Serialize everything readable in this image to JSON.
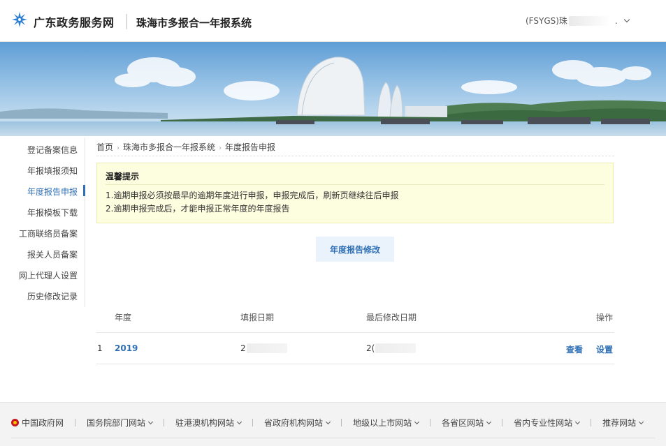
{
  "header": {
    "brand": "广东政务服务网",
    "system_title": "珠海市多报合一年报系统",
    "user_prefix": "(FSYGS)珠",
    "user_suffix": "."
  },
  "sidebar": {
    "items": [
      {
        "label": "登记备案信息",
        "active": false
      },
      {
        "label": "年报填报须知",
        "active": false
      },
      {
        "label": "年度报告申报",
        "active": true
      },
      {
        "label": "年报模板下载",
        "active": false
      },
      {
        "label": "工商联络员备案",
        "active": false
      },
      {
        "label": "报关人员备案",
        "active": false
      },
      {
        "label": "网上代理人设置",
        "active": false
      },
      {
        "label": "历史修改记录",
        "active": false
      }
    ]
  },
  "breadcrumb": {
    "items": [
      "首页",
      "珠海市多报合一年报系统",
      "年度报告申报"
    ],
    "separator": "›"
  },
  "notice": {
    "title": "温馨提示",
    "lines": [
      "1.逾期申报必须按最早的逾期年度进行申报，申报完成后，刷新页继续往后申报",
      "2.逾期申报完成后，才能申报正常年度的年度报告"
    ]
  },
  "actions": {
    "amend_label": "年度报告修改"
  },
  "table": {
    "headers": {
      "year": "年度",
      "fill_date": "填报日期",
      "last_modified": "最后修改日期",
      "operation": "操作"
    },
    "rows": [
      {
        "index": "1",
        "year": "2019",
        "fill_date_visible": "2",
        "last_modified_visible": "2(",
        "view_label": "查看",
        "setting_label": "设置"
      }
    ]
  },
  "footer": {
    "links": [
      {
        "label": "中国政府网",
        "has_dropdown": false,
        "icon": "national-emblem-icon"
      },
      {
        "label": "国务院部门网站",
        "has_dropdown": true
      },
      {
        "label": "驻港澳机构网站",
        "has_dropdown": true
      },
      {
        "label": "省政府机构网站",
        "has_dropdown": true
      },
      {
        "label": "地级以上市网站",
        "has_dropdown": true
      },
      {
        "label": "各省区网站",
        "has_dropdown": true
      },
      {
        "label": "省内专业性网站",
        "has_dropdown": true
      },
      {
        "label": "推荐网站",
        "has_dropdown": true
      }
    ]
  },
  "colors": {
    "accent": "#2f6fb5",
    "notice_bg": "#fdfde0",
    "button_bg": "#eaf3fb",
    "footer_bg": "#f3f3f3"
  }
}
